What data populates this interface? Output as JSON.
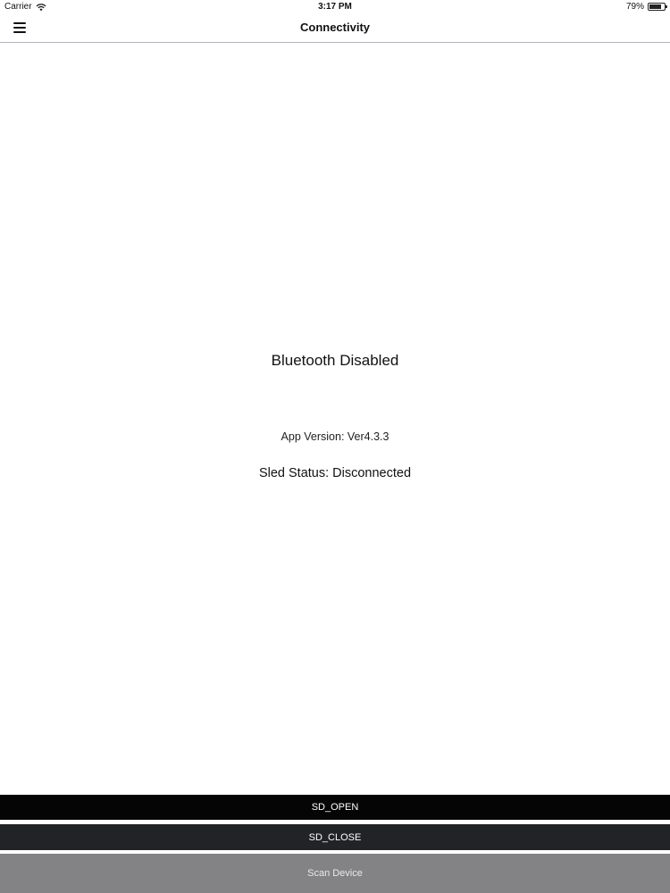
{
  "status_bar": {
    "carrier": "Carrier",
    "time": "3:17 PM",
    "battery_percent": "79%",
    "battery_level": 0.79,
    "wifi_icon": "wifi-icon",
    "battery_icon": "battery-icon"
  },
  "nav": {
    "title": "Connectivity",
    "menu_icon": "hamburger-menu-icon"
  },
  "main": {
    "bluetooth_status": "Bluetooth Disabled",
    "app_version": "App Version: Ver4.3.3",
    "sled_status": "Sled Status: Disconnected"
  },
  "buttons": {
    "sd_open": "SD_OPEN",
    "sd_close": "SD_CLOSE",
    "scan_device": "Scan Device"
  },
  "colors": {
    "sd_open_bg": "#050505",
    "sd_close_bg": "#222326",
    "scan_device_bg": "#838385",
    "nav_divider": "#b9b0c2"
  }
}
